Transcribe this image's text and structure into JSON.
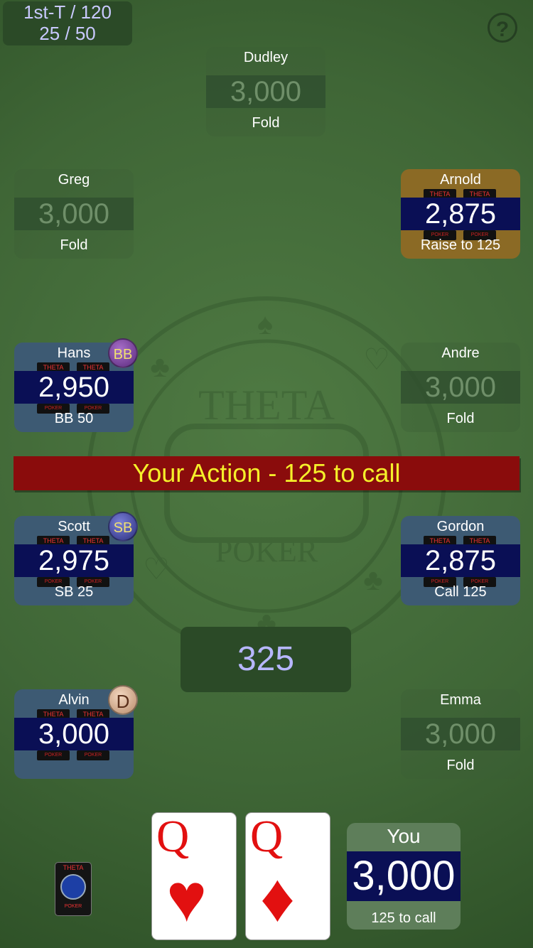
{
  "header": {
    "tournament": "1st-T / 120",
    "blinds": "25 / 50",
    "help_label": "?"
  },
  "felt": {
    "logo_top": "THETA",
    "logo_bottom": "POKER"
  },
  "chip_tag": {
    "top": "THETA",
    "bottom": "POKER"
  },
  "seats": {
    "dudley": {
      "name": "Dudley",
      "chips": "3,000",
      "action": "Fold"
    },
    "greg": {
      "name": "Greg",
      "chips": "3,000",
      "action": "Fold"
    },
    "arnold": {
      "name": "Arnold",
      "chips": "2,875",
      "action": "Raise to 125"
    },
    "hans": {
      "name": "Hans",
      "chips": "2,950",
      "action": "BB 50",
      "badge": "BB"
    },
    "andre": {
      "name": "Andre",
      "chips": "3,000",
      "action": "Fold"
    },
    "scott": {
      "name": "Scott",
      "chips": "2,975",
      "action": "SB 25",
      "badge": "SB"
    },
    "gordon": {
      "name": "Gordon",
      "chips": "2,875",
      "action": "Call 125"
    },
    "alvin": {
      "name": "Alvin",
      "chips": "3,000",
      "action": "",
      "badge": "D"
    },
    "emma": {
      "name": "Emma",
      "chips": "3,000",
      "action": "Fold"
    }
  },
  "banner": {
    "text": "Your Action - 125 to call"
  },
  "pot": {
    "amount": "325"
  },
  "hand": [
    {
      "rank": "Q",
      "suit": "♥"
    },
    {
      "rank": "Q",
      "suit": "♦"
    }
  ],
  "you": {
    "name": "You",
    "chips": "3,000",
    "status": "125 to call"
  },
  "deck": {
    "top": "THETA",
    "bottom": "POKER"
  }
}
